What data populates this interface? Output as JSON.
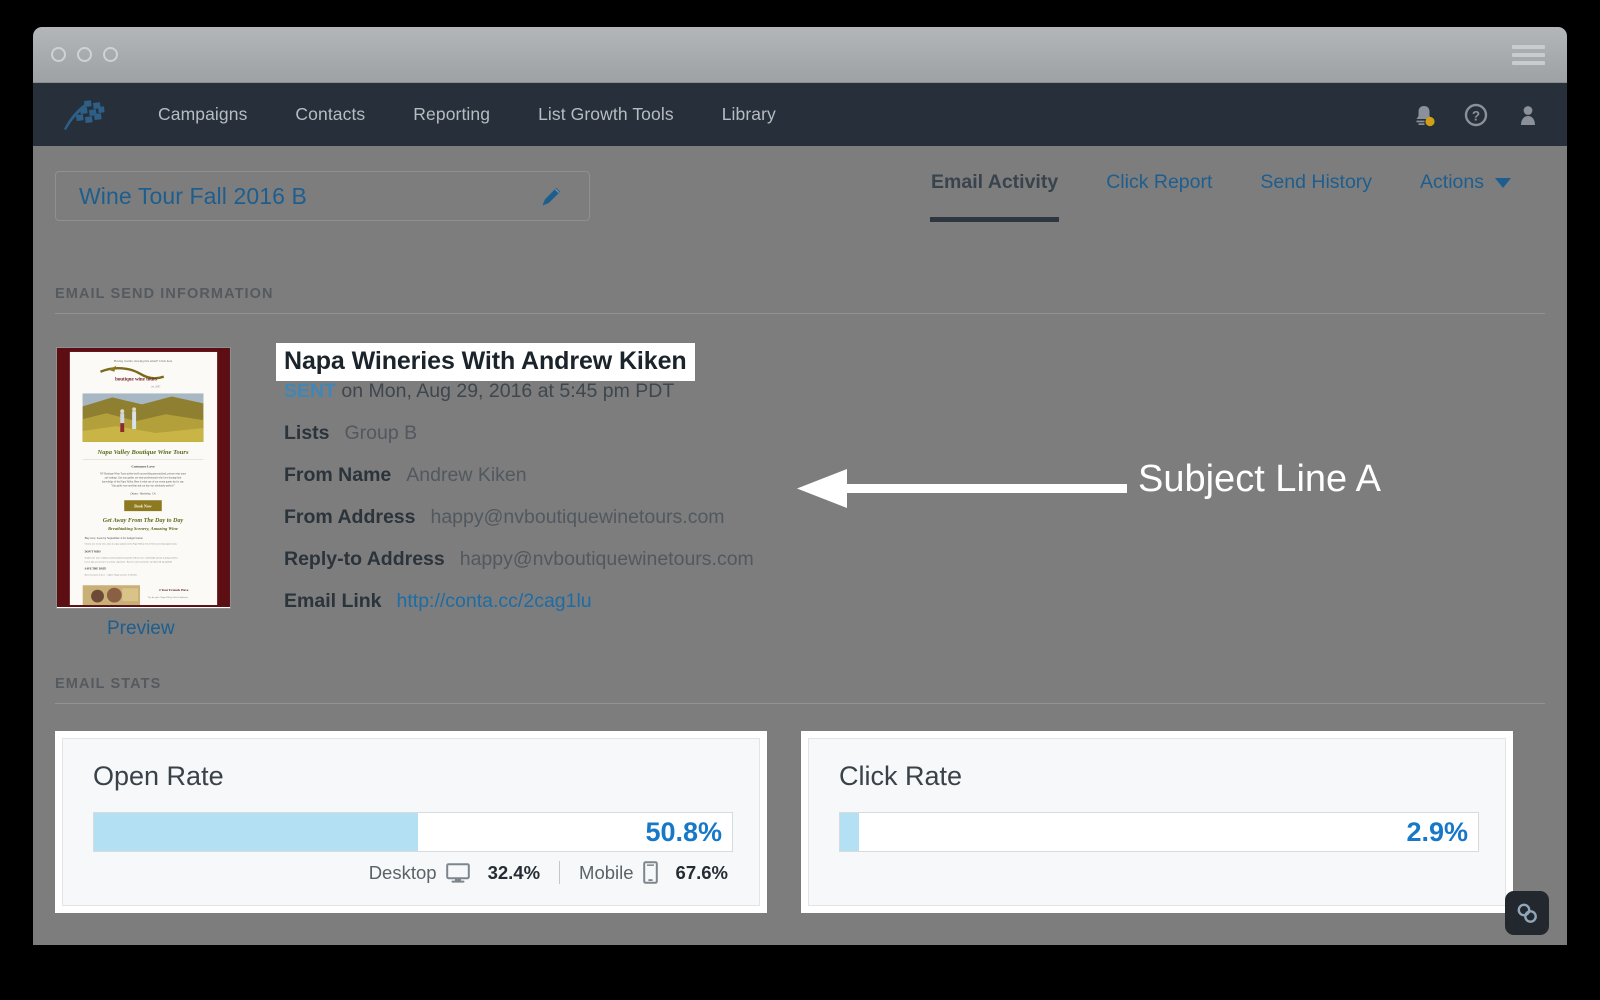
{
  "window": {
    "traffic_dots": 3,
    "menu_icon": "hamburger-icon"
  },
  "nav": {
    "logo_icon": "constant-contact-flag-logo",
    "links": [
      {
        "label": "Campaigns"
      },
      {
        "label": "Contacts"
      },
      {
        "label": "Reporting"
      },
      {
        "label": "List Growth Tools"
      },
      {
        "label": "Library"
      }
    ],
    "right_icons": [
      {
        "name": "notification-bell-icon"
      },
      {
        "name": "help-question-icon"
      },
      {
        "name": "user-avatar-icon"
      }
    ]
  },
  "campaign": {
    "name": "Wine Tour Fall 2016 B",
    "edit_icon": "pencil-icon"
  },
  "tabs": [
    {
      "label": "Email Activity",
      "active": true
    },
    {
      "label": "Click Report",
      "active": false
    },
    {
      "label": "Send History",
      "active": false
    }
  ],
  "actions": {
    "label": "Actions",
    "caret_icon": "chevron-down-icon"
  },
  "sections": {
    "send_information": "EMAIL SEND INFORMATION",
    "stats": "EMAIL STATS"
  },
  "email": {
    "subject": "Napa Wineries With Andrew Kiken",
    "status": "SENT",
    "sent_on": " on Mon, Aug 29, 2016 at 5:45 pm PDT",
    "preview_label": "Preview",
    "fields": [
      {
        "key": "Lists",
        "value": "Group B",
        "link": false
      },
      {
        "key": "From Name",
        "value": "Andrew Kiken",
        "link": false
      },
      {
        "key": "From Address",
        "value": "happy@nvboutiquewinetours.com",
        "link": false
      },
      {
        "key": "Reply-to Address",
        "value": "happy@nvboutiquewinetours.com",
        "link": false
      },
      {
        "key": "Email Link",
        "value": "http://conta.cc/2cag1lu",
        "link": true
      }
    ],
    "thumbnail": {
      "headline": "Napa Valley Boutique Wine Tours",
      "subhead": "Customer Love",
      "promo_line_1": "Get Away From The Day to Day",
      "promo_line_2": "Breathtaking Scenery, Amazing Wine",
      "button_label": "Book Now",
      "footer_heading": "4 Your Friends Have"
    }
  },
  "chart_data": [
    {
      "type": "bar",
      "title": "Open Rate",
      "orientation": "horizontal",
      "categories": [
        "Open Rate"
      ],
      "values": [
        50.8
      ],
      "value_label": "50.8%",
      "xlim": [
        0,
        100
      ],
      "unit": "%",
      "fill_color": "#b3e0f2",
      "value_color": "#1878c8",
      "grid": false,
      "legend": "none",
      "breakdown": {
        "type": "table",
        "rows": [
          {
            "label": "Desktop",
            "icon": "desktop-monitor-icon",
            "value": 32.4,
            "value_label": "32.4%"
          },
          {
            "label": "Mobile",
            "icon": "mobile-phone-icon",
            "value": 67.6,
            "value_label": "67.6%"
          }
        ]
      }
    },
    {
      "type": "bar",
      "title": "Click Rate",
      "orientation": "horizontal",
      "categories": [
        "Click Rate"
      ],
      "values": [
        2.9
      ],
      "value_label": "2.9%",
      "xlim": [
        0,
        100
      ],
      "unit": "%",
      "fill_color": "#b3e0f2",
      "value_color": "#1878c8",
      "grid": false,
      "legend": "none"
    }
  ],
  "annotation": {
    "label": "Subject Line A",
    "arrow": "left-arrow",
    "color": "#ffffff"
  },
  "badge": {
    "icon": "chain-link-icon"
  },
  "colors": {
    "nav_bg": "#262f3a",
    "page_overlay": "#7d7d7d",
    "link_blue": "#1d5e8e",
    "accent_blue": "#1878c8",
    "bar_fill": "#b3e0f2",
    "titlebar": "#a7abae"
  }
}
